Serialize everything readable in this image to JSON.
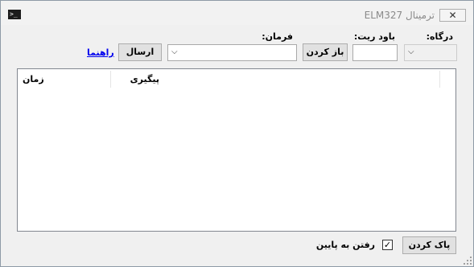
{
  "window": {
    "title": "ترمینال ELM327",
    "close_glyph": "✕",
    "icon_glyph": ">_"
  },
  "toolbar": {
    "port_label": "درگاه:",
    "port_value": "",
    "baud_label": "باود ریت:",
    "baud_value": "",
    "open_button": "باز کردن",
    "command_label": "فرمان:",
    "command_value": "",
    "send_button": "ارسال",
    "help_link": "راهنما",
    "dropdown_arrow": "⌵"
  },
  "log": {
    "columns": [
      "پیگیری",
      "زمان"
    ],
    "rows": []
  },
  "footer": {
    "clear_button": "پاک کردن",
    "autoscroll_label": "رفتن به پایین",
    "autoscroll_checked": true,
    "check_glyph": "✓"
  }
}
